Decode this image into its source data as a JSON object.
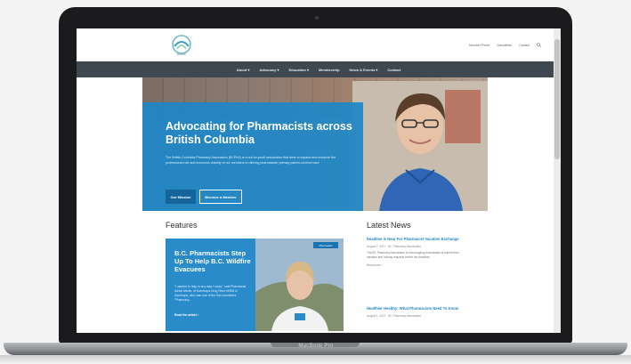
{
  "device": {
    "model_label": "MacBook Pro"
  },
  "colors": {
    "accent": "#1f86c6",
    "nav_bg": "#3f4851",
    "frame": "#1b1b1d"
  },
  "site": {
    "logo_text": "BCPhA",
    "util_nav": [
      "Member Portal",
      "Classifieds",
      "Contact"
    ],
    "main_nav": [
      "About ▾",
      "Advocacy ▾",
      "Education ▾",
      "Membership",
      "News & Events ▾",
      "Contact"
    ],
    "hero": {
      "title": "Advocating for Pharmacists across British Columbia",
      "body": "The British Columbia Pharmacy Association (BCPhA) is a not-for-profit association that aims to expand and enhance the professional role and economic viability of our members in offering pharmacists' primary patient-centred care.",
      "primary_button": "Our Mission",
      "secondary_button": "Become a Member"
    },
    "features": {
      "heading": "Features",
      "card": {
        "title": "B.C. Pharmacists Step Up To Help B.C. Wildfire Evacuees",
        "body": "\"I wanted to help in any way I could,\" said Pharmacist Alexis Martin, of Kamloops Drug Store WRW in Kamloops, who was one of the first volunteers. \"Pharmacy...",
        "more": "Read the article ›",
        "badge": "Pharmacist"
      }
    },
    "news": {
      "heading": "Latest News",
      "items": [
        {
          "title": "Deadline is Near For Pharmacist Vacation Exchange",
          "meta": "August 2, 2017  ·  BC Pharmacy Association",
          "excerpt": "The BC Pharmacy Association is encouraging pharmacists to submit their vacation and holiday requests before the deadline.",
          "more": "Read more ›"
        },
        {
          "title": "Healthier Healthy: What Pharmacists Need To Know",
          "meta": "August 1, 2017  ·  BC Pharmacy Association",
          "excerpt": "",
          "more": ""
        }
      ]
    }
  }
}
